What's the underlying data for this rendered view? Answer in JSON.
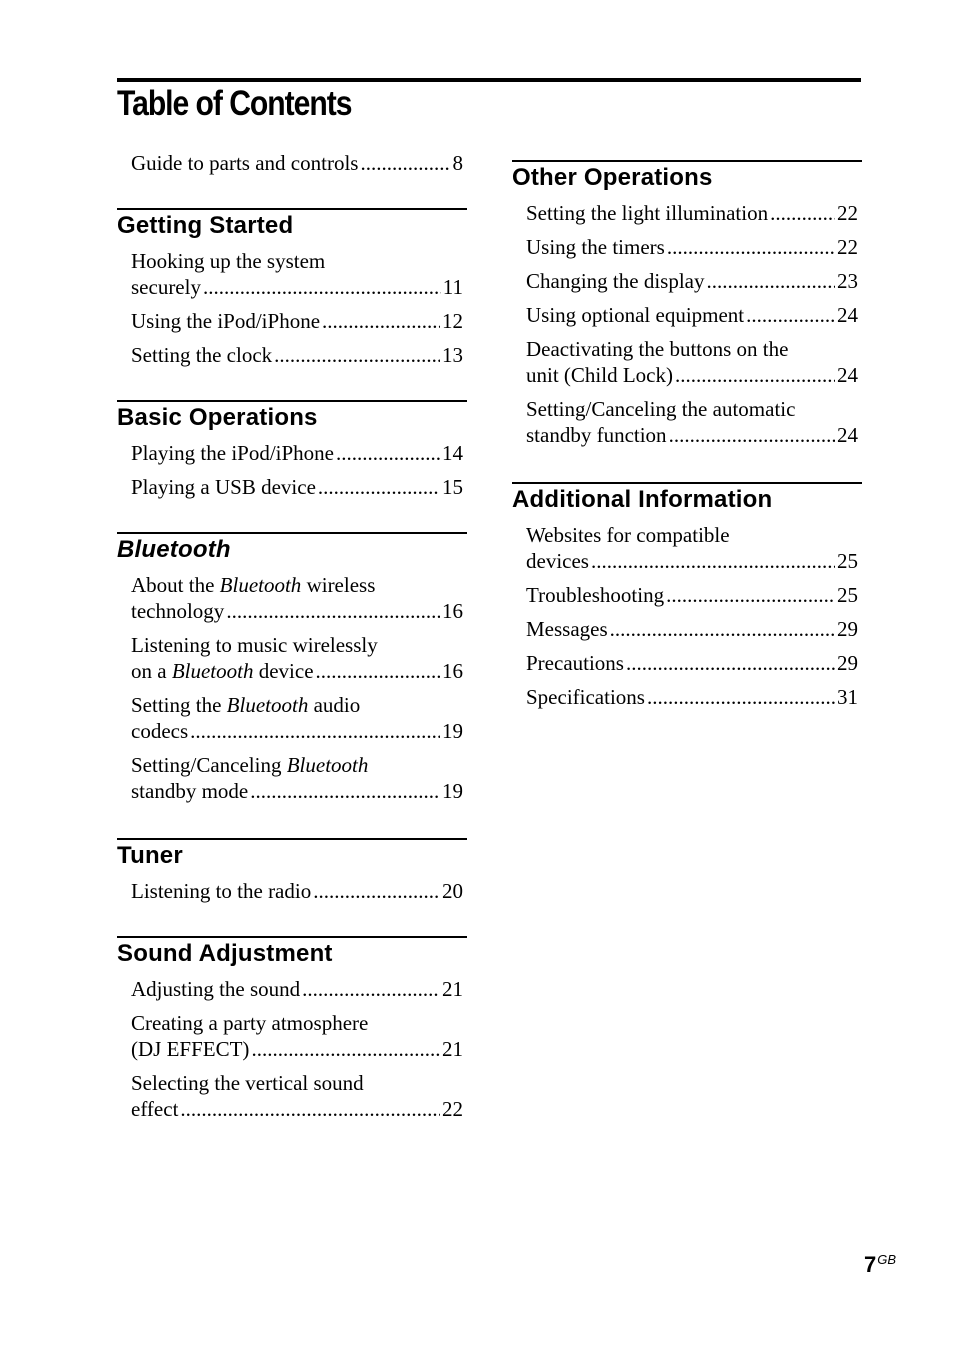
{
  "title": "Table of Contents",
  "intro_entry": {
    "text": "Guide to parts and controls",
    "page": "8"
  },
  "left_sections": [
    {
      "heading": "Getting Started",
      "italic": false,
      "entries": [
        {
          "line1": "Hooking up the system",
          "last": "securely",
          "page": "11"
        },
        {
          "last": "Using the iPod/iPhone",
          "page": "12"
        },
        {
          "last": "Setting the clock",
          "page": "13"
        }
      ]
    },
    {
      "heading": "Basic Operations",
      "italic": false,
      "entries": [
        {
          "last": "Playing the iPod/iPhone",
          "page": "14"
        },
        {
          "last": "Playing a USB device",
          "page": "15"
        }
      ]
    },
    {
      "heading": "Bluetooth",
      "italic": true,
      "entries": [
        {
          "line1_parts": [
            "About the ",
            "Bluetooth",
            " wireless"
          ],
          "last": "technology",
          "page": "16"
        },
        {
          "line1": "Listening to music wirelessly",
          "last_parts": [
            "on a ",
            "Bluetooth",
            " device"
          ],
          "page": "16"
        },
        {
          "line1_parts": [
            "Setting the ",
            "Bluetooth",
            " audio"
          ],
          "last": "codecs",
          "page": "19"
        },
        {
          "line1_parts": [
            "Setting/Canceling ",
            "Bluetooth",
            ""
          ],
          "last": "standby mode",
          "page": "19"
        }
      ]
    },
    {
      "heading": "Tuner",
      "italic": false,
      "entries": [
        {
          "last": "Listening to the radio",
          "page": "20"
        }
      ]
    },
    {
      "heading": "Sound Adjustment",
      "italic": false,
      "entries": [
        {
          "last": "Adjusting the sound",
          "page": "21"
        },
        {
          "line1": "Creating a party atmosphere",
          "last": "(DJ EFFECT)",
          "page": "21"
        },
        {
          "line1": "Selecting the vertical sound",
          "last": "effect",
          "page": "22"
        }
      ]
    }
  ],
  "right_sections": [
    {
      "heading": "Other Operations",
      "italic": false,
      "entries": [
        {
          "last": "Setting the light illumination",
          "page": "22"
        },
        {
          "last": "Using the timers",
          "page": "22"
        },
        {
          "last": "Changing the display",
          "page": "23"
        },
        {
          "last": "Using optional equipment",
          "page": "24"
        },
        {
          "line1": "Deactivating the buttons on the",
          "last": "unit (Child Lock)",
          "page": "24"
        },
        {
          "line1": "Setting/Canceling the automatic",
          "last": "standby function",
          "page": "24"
        }
      ]
    },
    {
      "heading": "Additional Information",
      "italic": false,
      "entries": [
        {
          "line1": "Websites for compatible",
          "last": "devices",
          "page": "25"
        },
        {
          "last": "Troubleshooting",
          "page": "25"
        },
        {
          "last": "Messages",
          "page": "29"
        },
        {
          "last": "Precautions",
          "page": "29"
        },
        {
          "last": "Specifications",
          "page": "31"
        }
      ]
    }
  ],
  "page_number": {
    "number": "7",
    "suffix": "GB"
  }
}
